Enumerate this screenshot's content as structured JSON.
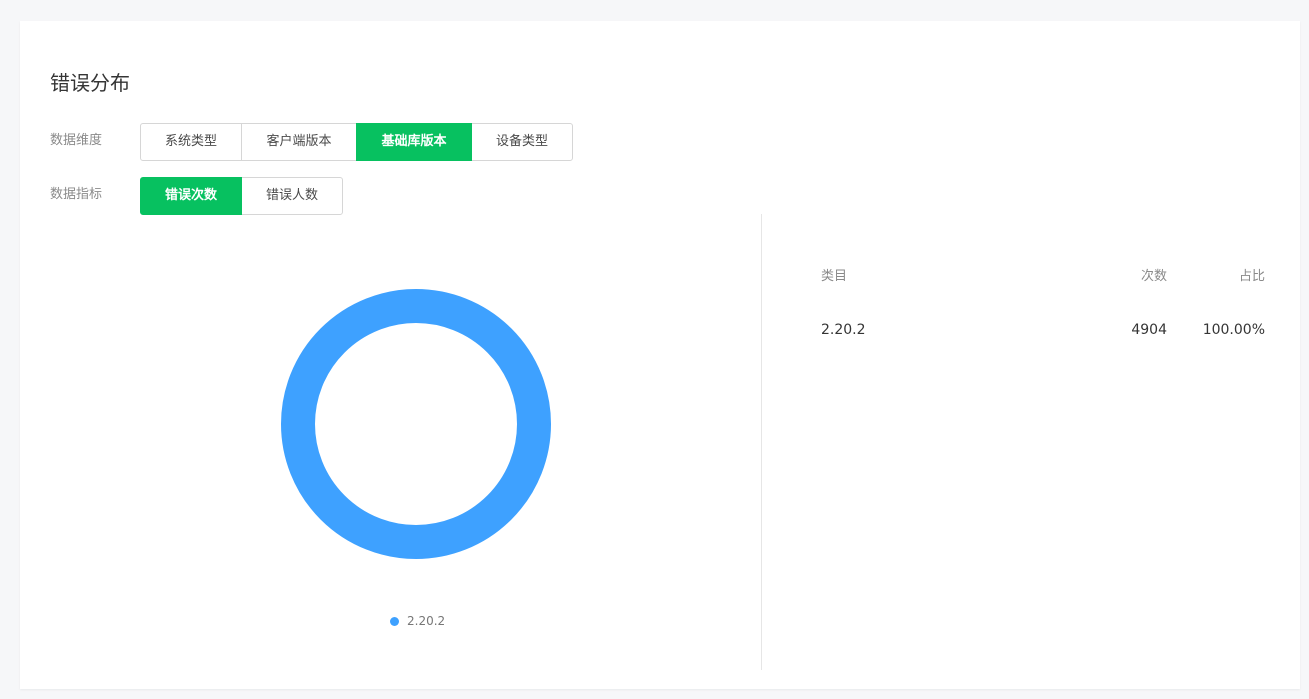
{
  "title": "错误分布",
  "filters": {
    "dimension": {
      "label": "数据维度",
      "options": [
        "系统类型",
        "客户端版本",
        "基础库版本",
        "设备类型"
      ],
      "active_index": 2
    },
    "metric": {
      "label": "数据指标",
      "options": [
        "错误次数",
        "错误人数"
      ],
      "active_index": 0
    }
  },
  "colors": {
    "accent": "#07c160",
    "series": "#3ea1ff"
  },
  "chart_data": {
    "type": "pie",
    "style": "donut",
    "categories": [
      "2.20.2"
    ],
    "values": [
      4904
    ],
    "legend": "bottom",
    "title": ""
  },
  "table": {
    "headers": [
      "类目",
      "次数",
      "占比"
    ],
    "rows": [
      [
        "2.20.2",
        "4904",
        "100.00%"
      ]
    ]
  }
}
